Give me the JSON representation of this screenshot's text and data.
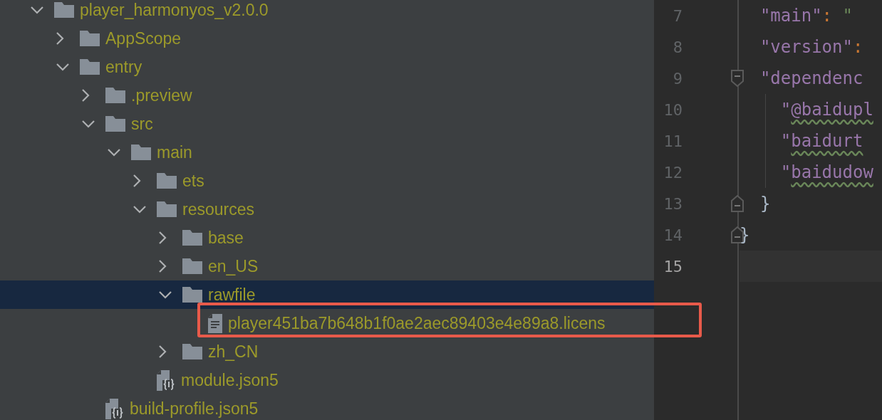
{
  "project_tree": [
    {
      "name": "player_harmonyos_v2.0.0",
      "kind": "folder",
      "expanded": true,
      "selected": false,
      "children": [
        {
          "name": "AppScope",
          "kind": "folder",
          "expanded": false,
          "selected": false
        },
        {
          "name": "entry",
          "kind": "folder",
          "expanded": true,
          "selected": false,
          "children": [
            {
              "name": ".preview",
              "kind": "folder",
              "expanded": false,
              "selected": false
            },
            {
              "name": "src",
              "kind": "folder",
              "expanded": true,
              "selected": false,
              "children": [
                {
                  "name": "main",
                  "kind": "folder",
                  "expanded": true,
                  "selected": false,
                  "children": [
                    {
                      "name": "ets",
                      "kind": "folder",
                      "expanded": false,
                      "selected": false
                    },
                    {
                      "name": "resources",
                      "kind": "folder",
                      "expanded": true,
                      "selected": false,
                      "children": [
                        {
                          "name": "base",
                          "kind": "folder",
                          "expanded": false,
                          "selected": false
                        },
                        {
                          "name": "en_US",
                          "kind": "folder",
                          "expanded": false,
                          "selected": false
                        },
                        {
                          "name": "rawfile",
                          "kind": "folder",
                          "expanded": true,
                          "selected": true,
                          "children": [
                            {
                              "name": "player451ba7b648b1f0ae2aec89403e4e89a8.licens",
                              "kind": "text",
                              "selected": false
                            }
                          ]
                        },
                        {
                          "name": "zh_CN",
                          "kind": "folder",
                          "expanded": false,
                          "selected": false
                        }
                      ]
                    },
                    {
                      "name": "module.json5",
                      "kind": "json",
                      "selected": false
                    }
                  ]
                }
              ]
            },
            {
              "name": "build-profile.json5",
              "kind": "json",
              "selected": false
            }
          ]
        }
      ]
    }
  ],
  "editor": {
    "lines": [
      {
        "number": "7",
        "kind": "plain",
        "current": false,
        "tokens": [
          {
            "text": "  \"main\"",
            "kind": "key",
            "warning": false
          },
          {
            "text": ":",
            "kind": "punct",
            "warning": false
          },
          {
            "text": " \"",
            "kind": "string",
            "warning": false
          }
        ]
      },
      {
        "number": "8",
        "kind": "plain",
        "current": false,
        "tokens": [
          {
            "text": "  \"version\"",
            "kind": "key",
            "warning": false
          },
          {
            "text": ":",
            "kind": "punct",
            "warning": false
          }
        ]
      },
      {
        "number": "9",
        "kind": "fold_start",
        "current": false,
        "tokens": [
          {
            "text": "  \"dependenc",
            "kind": "key",
            "warning": false
          }
        ]
      },
      {
        "number": "10",
        "kind": "nested",
        "current": false,
        "tokens": [
          {
            "text": "\"",
            "kind": "key",
            "warning": false
          },
          {
            "text": "@baidupl",
            "kind": "key",
            "warning": true
          }
        ]
      },
      {
        "number": "11",
        "kind": "nested",
        "current": false,
        "tokens": [
          {
            "text": "\"",
            "kind": "key",
            "warning": false
          },
          {
            "text": "baidurt",
            "kind": "key",
            "warning": true
          }
        ]
      },
      {
        "number": "12",
        "kind": "nested",
        "current": false,
        "tokens": [
          {
            "text": "\"",
            "kind": "key",
            "warning": false
          },
          {
            "text": "baidudow",
            "kind": "key",
            "warning": true
          }
        ]
      },
      {
        "number": "13",
        "kind": "fold_end",
        "current": false,
        "tokens": [
          {
            "text": "  }",
            "kind": "brace",
            "warning": false
          }
        ]
      },
      {
        "number": "14",
        "kind": "fold_end",
        "current": false,
        "tokens": [
          {
            "text": "}",
            "kind": "brace",
            "warning": false
          }
        ]
      },
      {
        "number": "15",
        "kind": "plain",
        "current": true
      }
    ]
  }
}
